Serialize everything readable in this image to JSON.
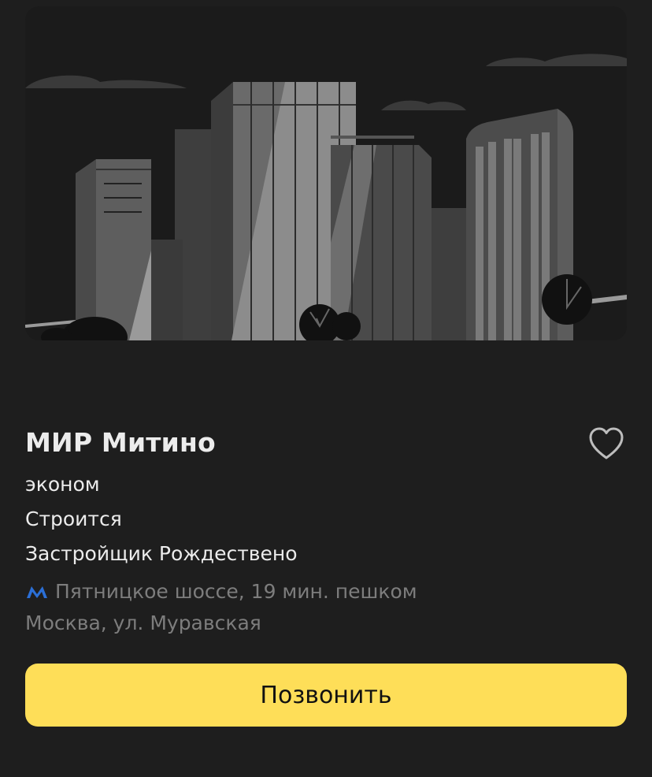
{
  "listing": {
    "title": "МИР Митино",
    "class": "эконом",
    "status": "Строится",
    "developer": "Застройщик Рождествено",
    "metro": {
      "text": "Пятницкое шоссе, 19 мин. пешком",
      "icon": "metro-icon",
      "color": "#2b6fd6"
    },
    "address": "Москва, ул. Муравская",
    "favorite_icon": "heart-outline-icon"
  },
  "actions": {
    "call_label": "Позвонить",
    "call_color": "#fede58"
  }
}
